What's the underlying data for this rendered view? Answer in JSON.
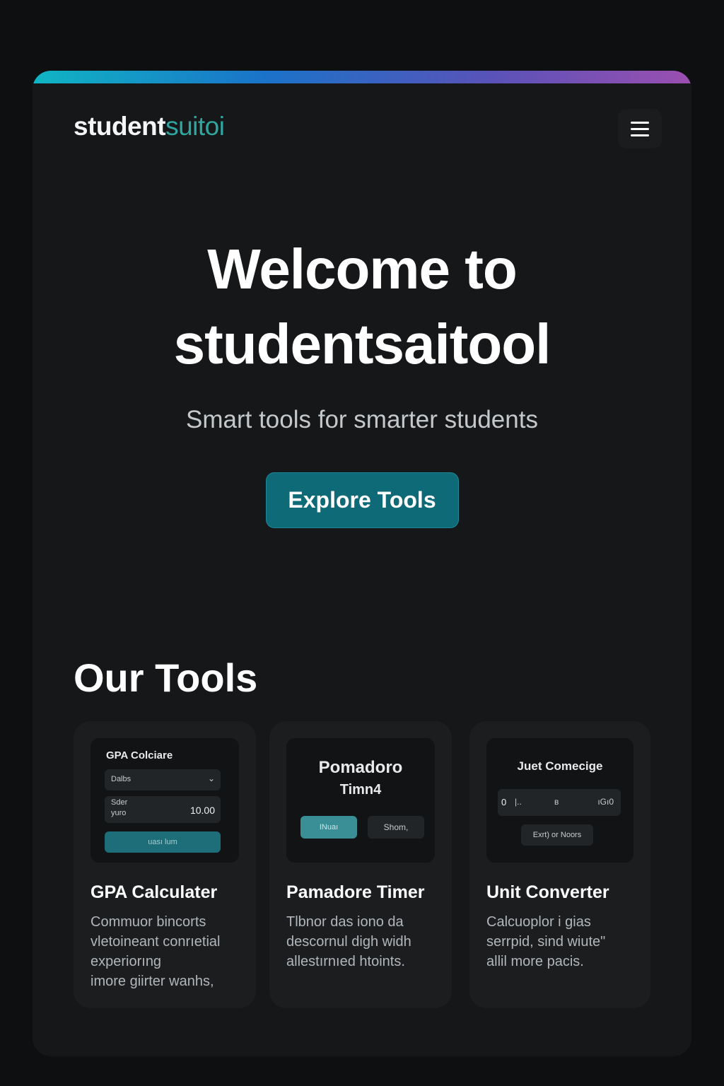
{
  "brand": {
    "part1": "student",
    "part2": "suitoi"
  },
  "colors": {
    "accent": "#2fa6a0",
    "cta": "#0f6a78",
    "background": "#151718"
  },
  "header": {
    "menu_icon": "hamburger-menu-icon"
  },
  "hero": {
    "title_line1": "Welcome to",
    "title_line2": "studentsaitool",
    "subtitle": "Smart tools for smarter students",
    "cta_label": "Explore Tools"
  },
  "tools": {
    "section_title": "Our Tools",
    "cards": [
      {
        "preview": {
          "title": "GPA Colciare",
          "select_value": "Dalbs",
          "field_label_1": "Sder",
          "field_label_2": "yuro",
          "field_value": "10.00",
          "button_label": "uası lum"
        },
        "title": "GPA Calculater",
        "desc_lines": [
          "Commuor bincorts",
          "vletoineant conrıetial",
          "experiorıng",
          "imore giirter wanhs,"
        ]
      },
      {
        "preview": {
          "title_line1": "Pomadoro",
          "title_line2": "Timn4",
          "button1_label": "INuaı",
          "button2_label": "Shom,"
        },
        "title": "Pamadore Timer",
        "desc_lines": [
          "Tlbnor das iono da",
          "descornul digh widh",
          "allestırnıed htoints."
        ]
      },
      {
        "preview": {
          "title": "Juet Comecige",
          "val_1": "0",
          "val_2": "|..",
          "val_3": "ʙ",
          "val_4": "ıGı0",
          "button_label": "Exrt) or Noors"
        },
        "title": "Unit Converter",
        "desc_lines": [
          "Calcuoplor i gias",
          "serrpid, sind wiute\"",
          "allil more pacis."
        ]
      }
    ]
  }
}
